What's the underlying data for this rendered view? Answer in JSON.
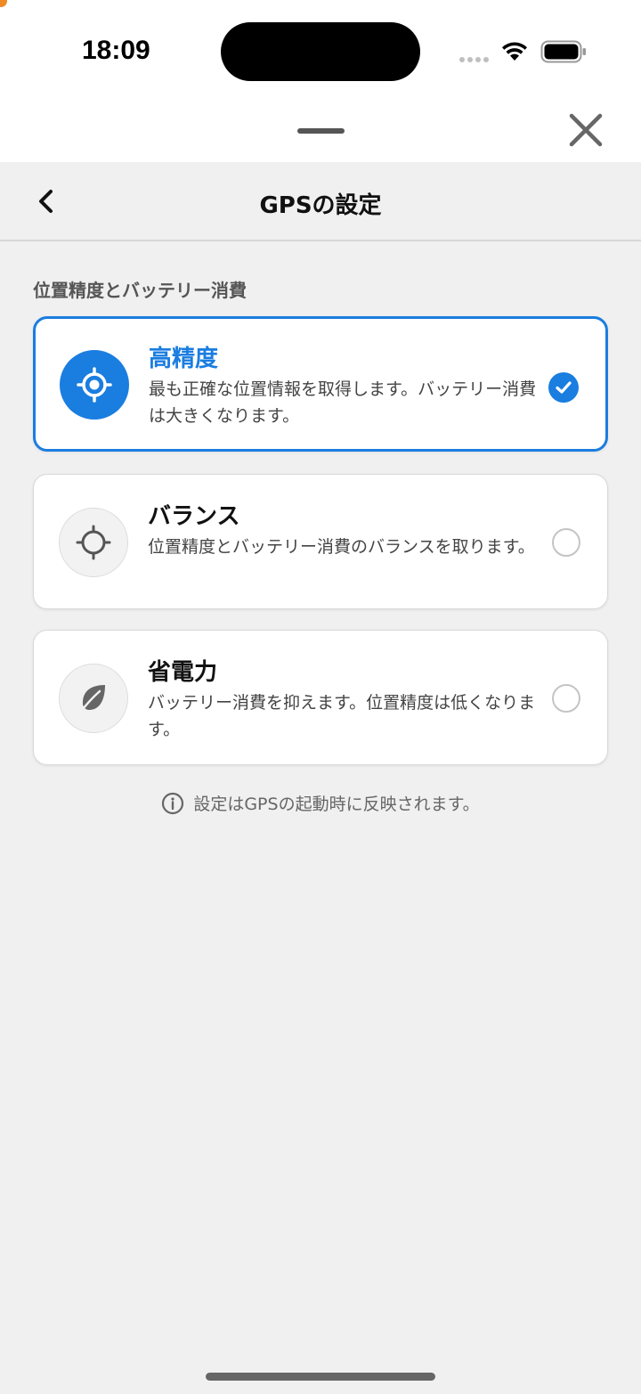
{
  "status_bar": {
    "time": "18:09"
  },
  "sheet": {
    "close_icon": "close-icon"
  },
  "header": {
    "title": "GPSの設定",
    "back_icon": "chevron-left-icon"
  },
  "section": {
    "label": "位置精度とバッテリー消費"
  },
  "options": [
    {
      "title": "高精度",
      "description": "最も正確な位置情報を取得します。バッテリー消費は大きくなります。",
      "icon": "target-icon",
      "selected": true
    },
    {
      "title": "バランス",
      "description": "位置精度とバッテリー消費のバランスを取ります。",
      "icon": "crosshair-icon",
      "selected": false
    },
    {
      "title": "省電力",
      "description": "バッテリー消費を抑えます。位置精度は低くなります。",
      "icon": "leaf-icon",
      "selected": false
    }
  ],
  "note": {
    "text": "設定はGPSの起動時に反映されます。",
    "icon": "info-icon"
  },
  "colors": {
    "accent": "#1a7de0",
    "background": "#f0f0f0"
  }
}
